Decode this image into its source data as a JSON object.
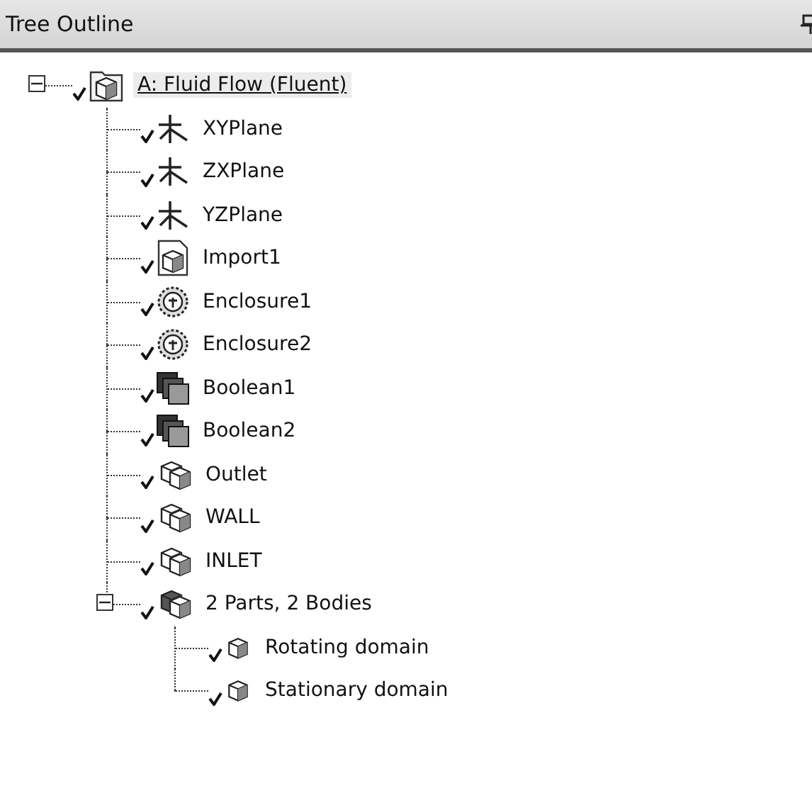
{
  "panel": {
    "title": "Tree Outline"
  },
  "tree": [
    {
      "label": "A: Fluid Flow (Fluent)",
      "kind": "model",
      "checked": true,
      "selected": true,
      "expanded": true,
      "children": [
        {
          "label": "XYPlane",
          "kind": "plane",
          "checked": true,
          "selected": false
        },
        {
          "label": "ZXPlane",
          "kind": "plane",
          "checked": true,
          "selected": false
        },
        {
          "label": "YZPlane",
          "kind": "plane",
          "checked": true,
          "selected": false
        },
        {
          "label": "Import1",
          "kind": "import",
          "checked": true,
          "selected": false
        },
        {
          "label": "Enclosure1",
          "kind": "enclosure",
          "checked": true,
          "selected": false
        },
        {
          "label": "Enclosure2",
          "kind": "enclosure",
          "checked": true,
          "selected": false
        },
        {
          "label": "Boolean1",
          "kind": "boolean",
          "checked": true,
          "selected": false
        },
        {
          "label": "Boolean2",
          "kind": "boolean",
          "checked": true,
          "selected": false
        },
        {
          "label": "Outlet",
          "kind": "selection",
          "checked": true,
          "selected": false
        },
        {
          "label": "WALL",
          "kind": "selection",
          "checked": true,
          "selected": false
        },
        {
          "label": "INLET",
          "kind": "selection",
          "checked": true,
          "selected": false
        },
        {
          "label": "2 Parts, 2 Bodies",
          "kind": "parts",
          "checked": true,
          "selected": false,
          "expanded": true,
          "children": [
            {
              "label": "Rotating domain",
              "kind": "body",
              "checked": true,
              "selected": false
            },
            {
              "label": "Stationary domain",
              "kind": "body",
              "checked": true,
              "selected": false
            }
          ]
        }
      ]
    }
  ]
}
